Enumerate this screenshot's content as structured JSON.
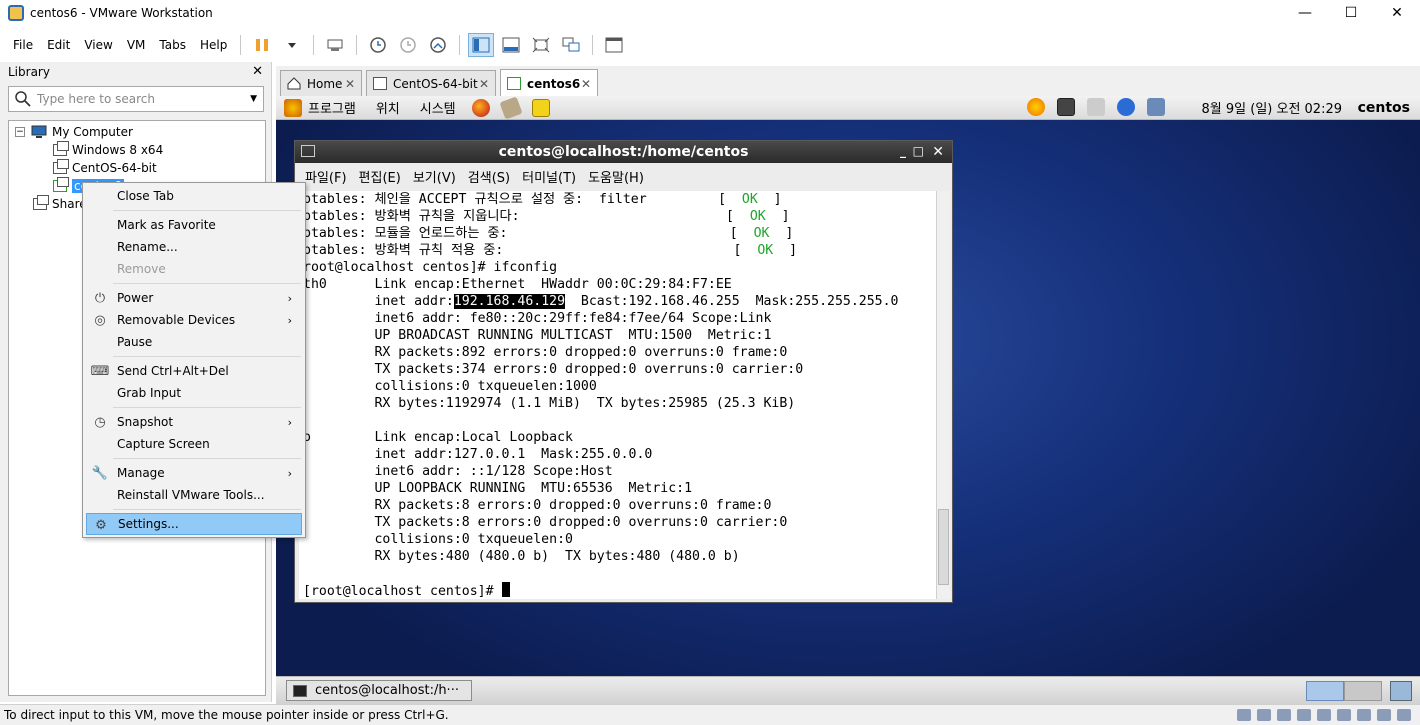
{
  "window": {
    "title": "centos6 - VMware Workstation",
    "minimize": "—",
    "maximize": "☐",
    "close": "✕"
  },
  "menubar": [
    "File",
    "Edit",
    "View",
    "VM",
    "Tabs",
    "Help"
  ],
  "library": {
    "title": "Library",
    "close": "✕",
    "search_placeholder": "Type here to search",
    "tree": {
      "root": "My Computer",
      "items": [
        "Windows 8 x64",
        "CentOS-64-bit",
        "centos6"
      ],
      "shared": "Shared VMs"
    }
  },
  "context_menu": {
    "items": [
      {
        "label": "Close Tab"
      },
      {
        "label": "Mark as Favorite"
      },
      {
        "label": "Rename..."
      },
      {
        "label": "Remove",
        "disabled": true
      },
      {
        "label": "Power",
        "submenu": true
      },
      {
        "label": "Removable Devices",
        "submenu": true
      },
      {
        "label": "Pause"
      },
      {
        "label": "Send Ctrl+Alt+Del"
      },
      {
        "label": "Grab Input"
      },
      {
        "label": "Snapshot",
        "submenu": true
      },
      {
        "label": "Capture Screen"
      },
      {
        "label": "Manage",
        "submenu": true
      },
      {
        "label": "Reinstall VMware Tools..."
      },
      {
        "label": "Settings...",
        "highlighted": true
      }
    ]
  },
  "tabs": [
    {
      "label": "Home"
    },
    {
      "label": "CentOS-64-bit"
    },
    {
      "label": "centos6",
      "active": true
    }
  ],
  "guest": {
    "panel_menus": [
      "프로그램",
      "위치",
      "시스템"
    ],
    "clock": "8월  9일 (일) 오전 02:29",
    "user": "centos",
    "terminal": {
      "title": "centos@localhost:/home/centos",
      "menus": [
        "파일(F)",
        "편집(E)",
        "보기(V)",
        "검색(S)",
        "터미널(T)",
        "도움말(H)"
      ],
      "lines": [
        {
          "text": "ptables: 체인을 ACCEPT 규칙으로 설정 중:  filter         [  ",
          "ok": "OK",
          "tail": "  ]"
        },
        {
          "text": "ptables: 방화벽 규칙을 지웁니다:                          [  ",
          "ok": "OK",
          "tail": "  ]"
        },
        {
          "text": "ptables: 모듈을 언로드하는 중:                            [  ",
          "ok": "OK",
          "tail": "  ]"
        },
        {
          "text": "ptables: 방화벽 규칙 적용 중:                             [  ",
          "ok": "OK",
          "tail": "  ]"
        },
        {
          "text": "root@localhost centos]# ifconfig"
        },
        {
          "text": "th0      Link encap:Ethernet  HWaddr 00:0C:29:84:F7:EE"
        },
        {
          "pre": "         inet addr:",
          "hl": "192.168.46.129",
          "post": "  Bcast:192.168.46.255  Mask:255.255.255.0"
        },
        {
          "text": "         inet6 addr: fe80::20c:29ff:fe84:f7ee/64 Scope:Link"
        },
        {
          "text": "         UP BROADCAST RUNNING MULTICAST  MTU:1500  Metric:1"
        },
        {
          "text": "         RX packets:892 errors:0 dropped:0 overruns:0 frame:0"
        },
        {
          "text": "         TX packets:374 errors:0 dropped:0 overruns:0 carrier:0"
        },
        {
          "text": "         collisions:0 txqueuelen:1000"
        },
        {
          "text": "         RX bytes:1192974 (1.1 MiB)  TX bytes:25985 (25.3 KiB)"
        },
        {
          "text": ""
        },
        {
          "text": "o        Link encap:Local Loopback"
        },
        {
          "text": "         inet addr:127.0.0.1  Mask:255.0.0.0"
        },
        {
          "text": "         inet6 addr: ::1/128 Scope:Host"
        },
        {
          "text": "         UP LOOPBACK RUNNING  MTU:65536  Metric:1"
        },
        {
          "text": "         RX packets:8 errors:0 dropped:0 overruns:0 frame:0"
        },
        {
          "text": "         TX packets:8 errors:0 dropped:0 overruns:0 carrier:0"
        },
        {
          "text": "         collisions:0 txqueuelen:0"
        },
        {
          "text": "         RX bytes:480 (480.0 b)  TX bytes:480 (480.0 b)"
        },
        {
          "text": ""
        },
        {
          "text": "[root@localhost centos]# ",
          "cursor": true
        }
      ]
    },
    "taskbar_button": "centos@localhost:/h···"
  },
  "statusbar": {
    "text": "To direct input to this VM, move the mouse pointer inside or press Ctrl+G."
  },
  "colors": {
    "accent": "#3399ff",
    "ok_green": "#1ea52a",
    "menu_highlight": "#91c9f7"
  }
}
